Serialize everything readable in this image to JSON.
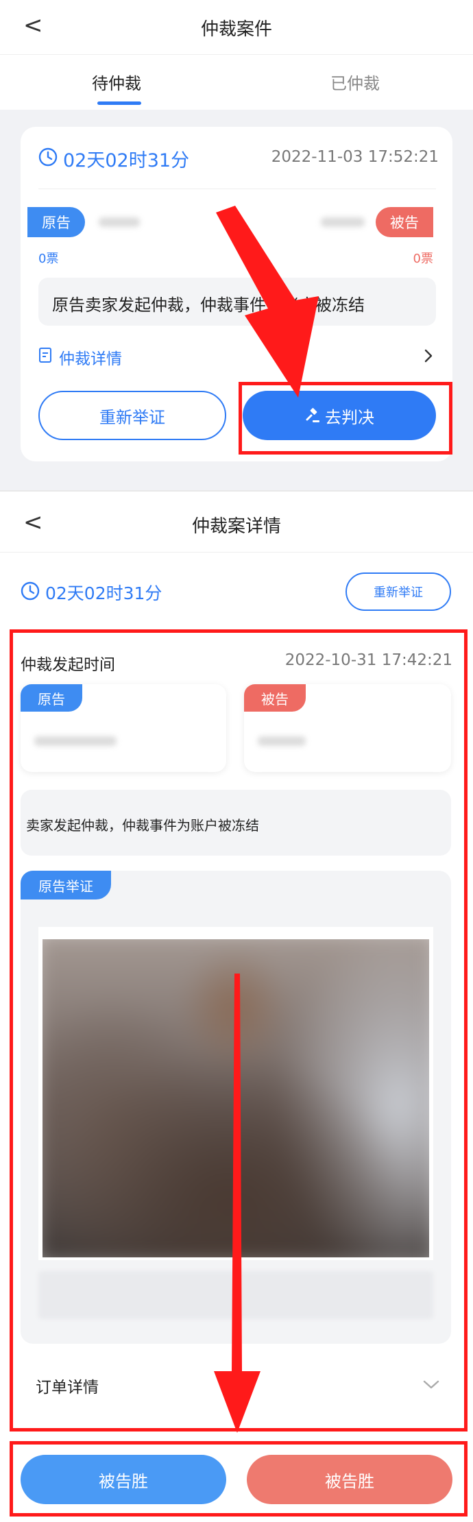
{
  "screen1": {
    "title": "仲裁案件",
    "back": "<",
    "tabs": [
      {
        "label": "待仲裁",
        "active": true
      },
      {
        "label": "已仲裁",
        "active": false
      }
    ],
    "card": {
      "countdown": "02天02时31分",
      "datetime": "2022-11-03 17:52:21",
      "plaintiff_badge": "原告",
      "defendant_badge": "被告",
      "plaintiff_votes": "0票",
      "defendant_votes": "0票",
      "description": "原告卖家发起仲裁，仲裁事件为账户被冻结",
      "detail_link": "仲裁详情",
      "re_evidence_button": "重新举证",
      "judge_button": "去判决"
    }
  },
  "screen2": {
    "title": "仲裁案详情",
    "back": "<",
    "countdown": "02天02时31分",
    "re_evidence_button": "重新举证",
    "start_time_label": "仲裁发起时间",
    "start_time_value": "2022-10-31 17:42:21",
    "plaintiff_badge": "原告",
    "defendant_badge": "被告",
    "description": "卖家发起仲裁，仲裁事件为账户被冻结",
    "evidence_badge": "原告举证",
    "order_detail_label": "订单详情",
    "defendant_win_button_1": "被告胜",
    "defendant_win_button_2": "被告胜"
  },
  "colors": {
    "accent": "#2f7bf5",
    "red": "#ee6b63",
    "annotation_red": "#ff1a1a"
  },
  "icons": [
    "chevron-left-icon",
    "clock-icon",
    "document-icon",
    "chevron-right-icon",
    "gavel-icon",
    "chevron-down-icon",
    "arrow-annotation-icon"
  ]
}
